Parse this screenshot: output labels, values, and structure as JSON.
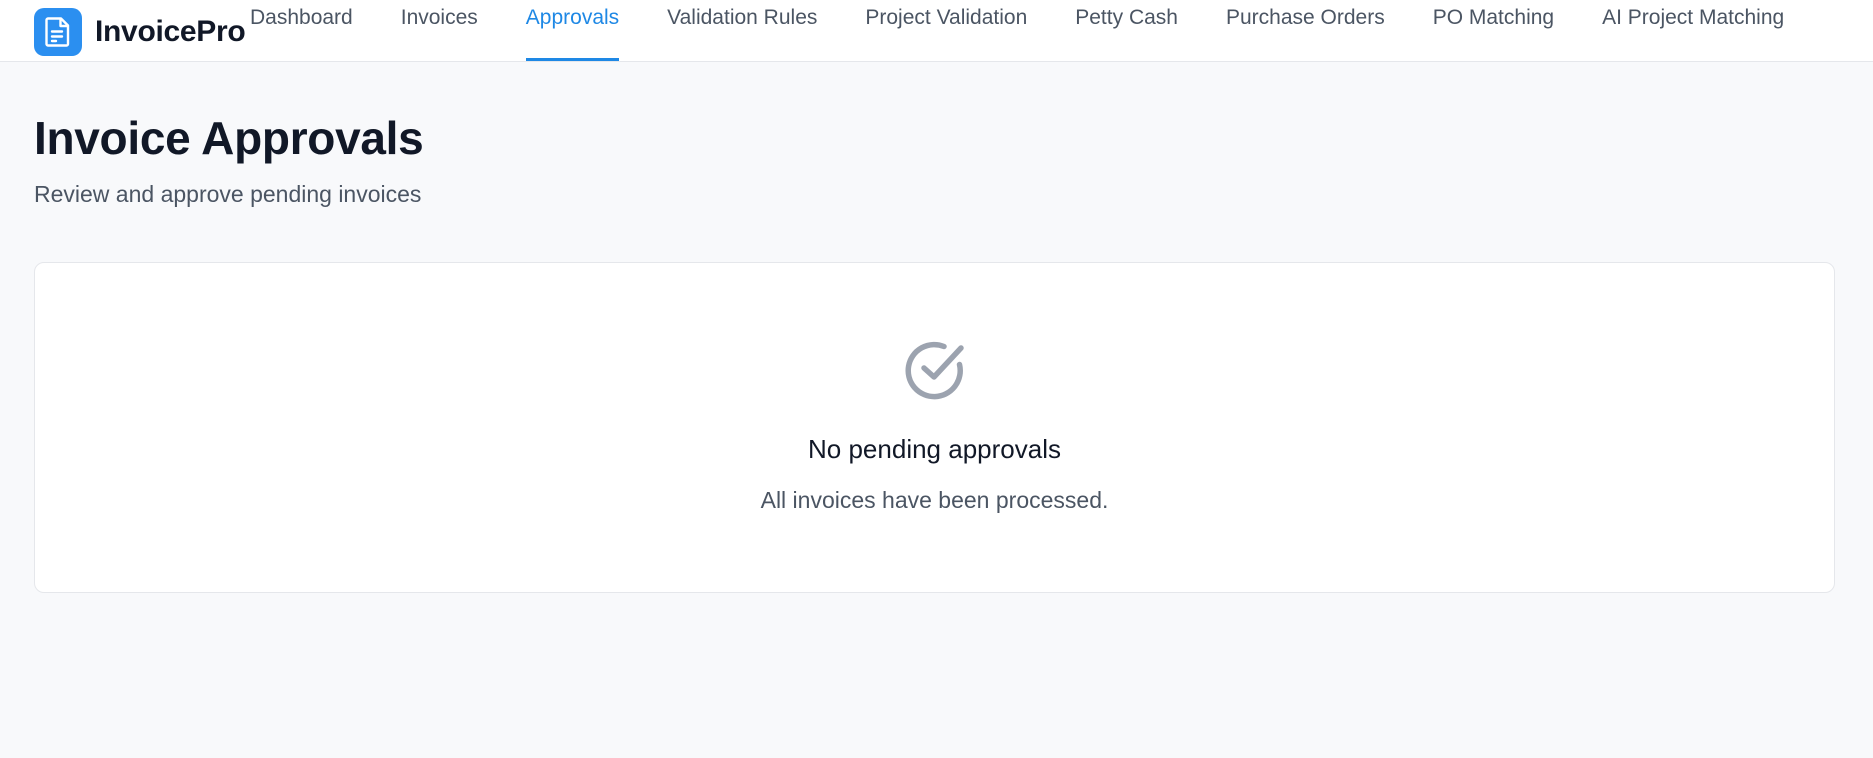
{
  "app": {
    "name": "InvoicePro",
    "logo_icon": "document-icon",
    "accent_color": "#1e88e5"
  },
  "nav": {
    "tabs": [
      {
        "label": "Dashboard",
        "active": false
      },
      {
        "label": "Invoices",
        "active": false
      },
      {
        "label": "Approvals",
        "active": true
      },
      {
        "label": "Validation Rules",
        "active": false
      },
      {
        "label": "Project Validation",
        "active": false
      },
      {
        "label": "Petty Cash",
        "active": false
      },
      {
        "label": "Purchase Orders",
        "active": false
      },
      {
        "label": "PO Matching",
        "active": false
      },
      {
        "label": "AI Project Matching",
        "active": false
      }
    ]
  },
  "page": {
    "title": "Invoice Approvals",
    "subtitle": "Review and approve pending invoices"
  },
  "empty_state": {
    "icon": "check-circle-icon",
    "title": "No pending approvals",
    "message": "All invoices have been processed."
  }
}
